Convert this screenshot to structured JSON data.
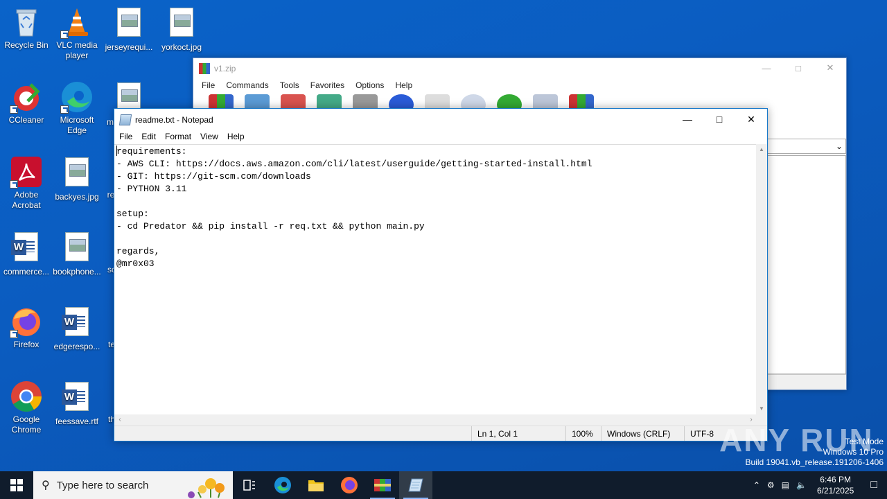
{
  "desktop": {
    "icons": [
      {
        "label": "Recycle Bin"
      },
      {
        "label": "VLC media player"
      },
      {
        "label": "jerseyrequi..."
      },
      {
        "label": "yorkoct.jpg"
      },
      {
        "label": "CCleaner"
      },
      {
        "label": "Microsoft Edge"
      },
      {
        "label": "m"
      },
      {
        "label": "Adobe Acrobat"
      },
      {
        "label": "backyes.jpg"
      },
      {
        "label": "re"
      },
      {
        "label": "commerce..."
      },
      {
        "label": "bookphone..."
      },
      {
        "label": "sc"
      },
      {
        "label": "Firefox"
      },
      {
        "label": "edgerespo..."
      },
      {
        "label": "te"
      },
      {
        "label": "Google Chrome"
      },
      {
        "label": "feessave.rtf"
      },
      {
        "label": "th"
      }
    ]
  },
  "winrar": {
    "title": "v1.zip",
    "menu": [
      "File",
      "Commands",
      "Tools",
      "Favorites",
      "Options",
      "Help"
    ]
  },
  "notepad": {
    "title": "readme.txt - Notepad",
    "menu": [
      "File",
      "Edit",
      "Format",
      "View",
      "Help"
    ],
    "content": "requirements:\n- AWS CLI: https://docs.aws.amazon.com/cli/latest/userguide/getting-started-install.html\n- GIT: https://git-scm.com/downloads\n- PYTHON 3.11\n\nsetup:\n- cd Predator && pip install -r req.txt && python main.py\n\nregards,\n@mr0x03",
    "status": {
      "position": "Ln 1, Col 1",
      "zoom": "100%",
      "line_ending": "Windows (CRLF)",
      "encoding": "UTF-8"
    }
  },
  "watermark": "ANY RUN",
  "system": {
    "mode": "Test Mode",
    "os": "Windows 10 Pro",
    "build": "Build 19041.vb_release.191206-1406"
  },
  "taskbar": {
    "search_placeholder": "Type here to search",
    "time": "6:46 PM",
    "date": "6/21/2025"
  }
}
